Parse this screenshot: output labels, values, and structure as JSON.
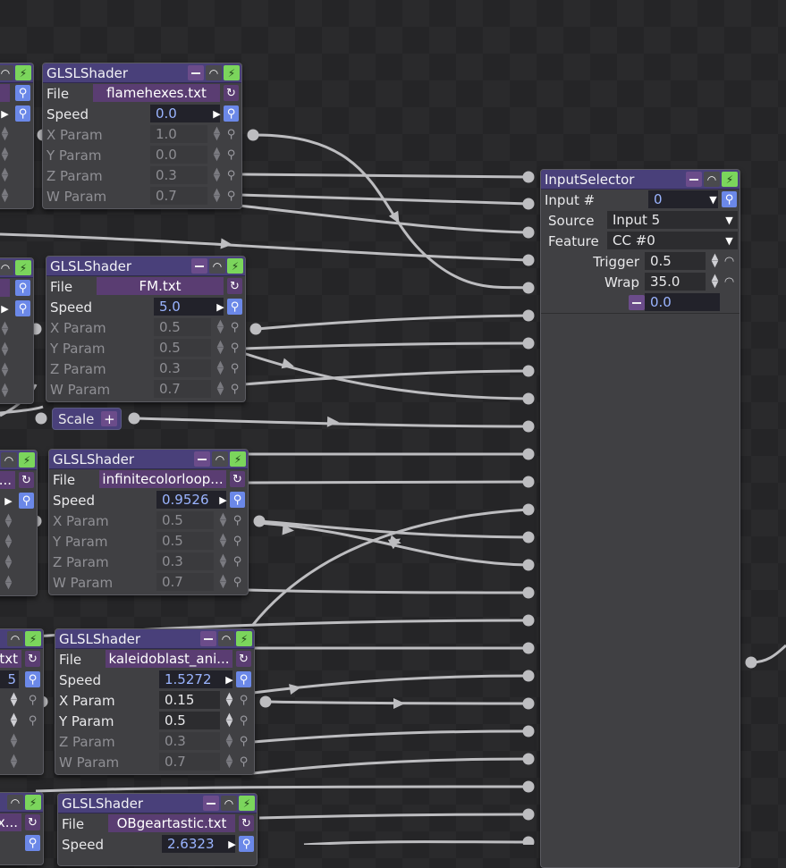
{
  "node_title": "GLSLShader",
  "labels": {
    "file": "File",
    "speed": "Speed",
    "x": "X Param",
    "y": "Y Param",
    "z": "Z Param",
    "w": "W Param"
  },
  "shaders": [
    {
      "file": "flamehexes.txt",
      "speed": "0.0",
      "x": "1.0",
      "y": "0.0",
      "z": "0.3",
      "w": "0.7"
    },
    {
      "file": "FM.txt",
      "speed": "5.0",
      "x": "0.5",
      "y": "0.5",
      "z": "0.3",
      "w": "0.7"
    },
    {
      "file": "infinitecolorloop...",
      "speed": "0.9526",
      "x": "0.5",
      "y": "0.5",
      "z": "0.3",
      "w": "0.7"
    },
    {
      "file": "kaleidoblast_ani...",
      "speed": "1.5272",
      "x": "0.15",
      "y": "0.5",
      "z": "0.3",
      "w": "0.7"
    },
    {
      "file": "OBgeartastic.txt",
      "speed": "2.6323"
    }
  ],
  "partial": {
    "r3_file": "...",
    "r4_file": "txt",
    "r4_speed": "5",
    "r5_file": "x..."
  },
  "scale": {
    "label": "Scale",
    "plus": "+"
  },
  "input_selector": {
    "title": "InputSelector",
    "input_label": "Input #",
    "input_value": "0",
    "source_label": "Source",
    "source_value": "Input 5",
    "feature_label": "Feature",
    "feature_value": "CC #0",
    "trigger_label": "Trigger",
    "trigger_value": "0.5",
    "wrap_label": "Wrap",
    "wrap_value": "35.0",
    "output_value": "0.0"
  },
  "colors": {
    "header": "#49407a",
    "accent": "#6b88e8",
    "bolt": "#7bd55c",
    "file": "#5a3d72",
    "background": "#252527"
  }
}
